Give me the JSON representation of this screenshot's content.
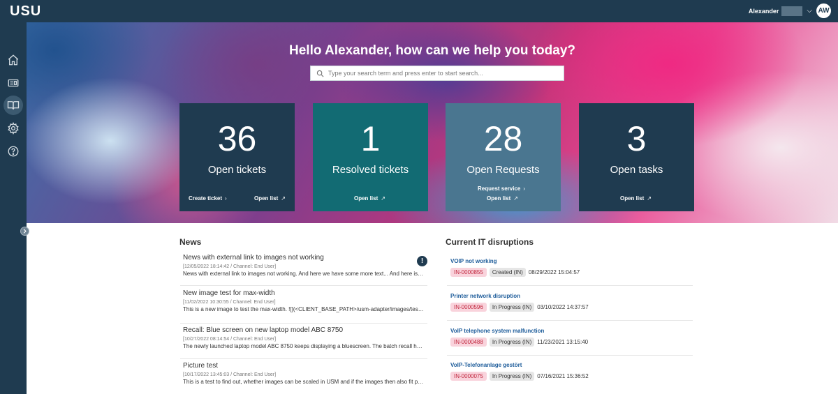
{
  "app": {
    "logo": "USU"
  },
  "user": {
    "name": "Alexander",
    "initials": "AW"
  },
  "sidebar": {
    "items": [
      {
        "icon": "home-icon"
      },
      {
        "icon": "ticket-card-icon"
      },
      {
        "icon": "book-icon",
        "active": true
      },
      {
        "icon": "gear-icon"
      },
      {
        "icon": "help-icon"
      }
    ]
  },
  "hero": {
    "title": "Hello Alexander, how can we help you today?",
    "search_placeholder": "Type your search term and press enter to start search..."
  },
  "tiles": [
    {
      "number": "36",
      "label": "Open tickets",
      "link1": "Create ticket",
      "link2": "Open list",
      "color": "#1f3b50"
    },
    {
      "number": "1",
      "label": "Resolved tickets",
      "link2": "Open list",
      "color": "#126b73"
    },
    {
      "number": "28",
      "label": "Open Requests",
      "link1": "Request service",
      "link2": "Open list",
      "color": "#4a7690"
    },
    {
      "number": "3",
      "label": "Open tasks",
      "link2": "Open list",
      "color": "#1f3b50"
    }
  ],
  "news": {
    "title": "News",
    "items": [
      {
        "title": "News with external link to images not working",
        "meta": "[12/05/2022 18:14:42 / Channel: End User]",
        "text": "News with external link to images not working. And here we have some more text... And here is even more text to show",
        "alert": true
      },
      {
        "title": "New image test for max-width",
        "meta": "[11/02/2022 10:30:55 / Channel: End User]",
        "text": "This is a new image to test the max-width. ![](<CLIENT_BASE_PATH>/usm-adapter/images/test.png)"
      },
      {
        "title": "Recall: Blue screen on new laptop model ABC 8750",
        "meta": "[10/27/2022 08:14:54 / Channel: End User]",
        "text": "The newly launched laptop model ABC 8750 keeps displaying a bluescreen. The batch recall has been initiated."
      },
      {
        "title": "Picture test",
        "meta": "[10/17/2022 13:45:03 / Channel: End User]",
        "text": "This is a test to find out, whether images can be scaled in USM and if the images then also fit properly"
      }
    ]
  },
  "disruptions": {
    "title": "Current IT disruptions",
    "items": [
      {
        "title": "VOIP not working",
        "id": "IN-0000855",
        "status": "Created (IN)",
        "date": "08/29/2022 15:04:57"
      },
      {
        "title": "Printer network disruption",
        "id": "IN-0000596",
        "status": "In Progress (IN)",
        "date": "03/10/2022 14:37:57"
      },
      {
        "title": "VoIP telephone system malfunction",
        "id": "IN-0000488",
        "status": "In Progress (IN)",
        "date": "11/23/2021 13:15:40"
      },
      {
        "title": "VoIP-Telefonanlage gestört",
        "id": "IN-0000075",
        "status": "In Progress (IN)",
        "date": "07/16/2021 15:36:52"
      }
    ]
  }
}
